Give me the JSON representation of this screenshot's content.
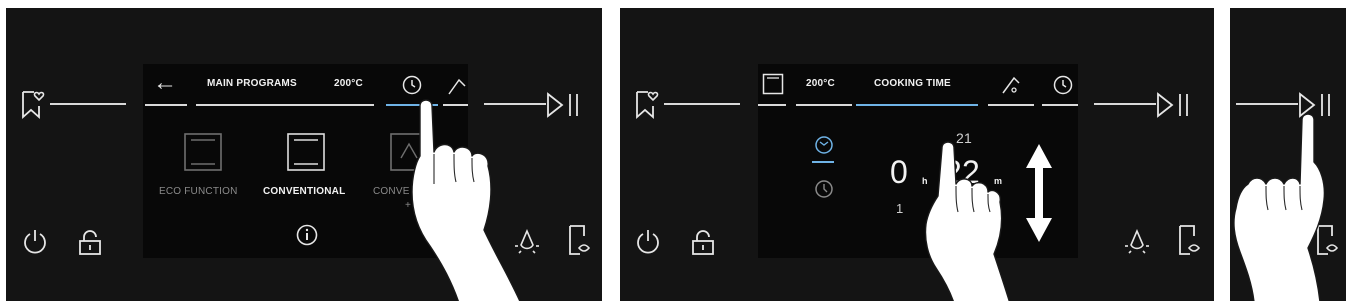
{
  "panel1": {
    "top_bar": {
      "back_label": "←",
      "title": "MAIN PROGRAMS",
      "temperature": "200°C"
    },
    "programs": [
      {
        "label": "ECO FUNCTION",
        "icon": "eco-function-icon",
        "selected": false
      },
      {
        "label": "CONVENTIONAL",
        "icon": "conventional-icon",
        "selected": true
      },
      {
        "label": "CONVE",
        "label_line2": "+ FA",
        "icon": "convection-fan-icon",
        "selected": false
      }
    ],
    "info_icon": "info-icon"
  },
  "panel2": {
    "top_bar": {
      "temperature": "200°C",
      "title": "COOKING TIME"
    },
    "timer": {
      "hours": "0",
      "hours_unit": "h",
      "minutes": "22",
      "minutes_unit": "m",
      "next_value": "21",
      "prev_value": "1"
    }
  },
  "colors": {
    "panel_background": "#141414",
    "screen_background": "#080808",
    "accent_blue": "#6fb3e6",
    "text": "#f2f2f2",
    "dim_text": "#8a8a8a"
  }
}
